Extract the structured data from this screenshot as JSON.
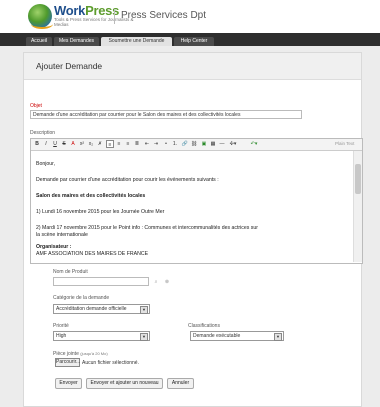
{
  "header": {
    "logo_word1": "Work",
    "logo_word2": "Press",
    "logo_tagline": "Tools & Press Services for Journalists & Medias",
    "title": "Press Services Dpt"
  },
  "tabs": [
    {
      "label": "Accueil",
      "active": false
    },
    {
      "label": "Mes Demandes",
      "active": false
    },
    {
      "label": "Soumettre une Demande",
      "active": true
    },
    {
      "label": "Help Center",
      "active": false
    }
  ],
  "panel": {
    "title": "Ajouter Demande"
  },
  "form": {
    "objet_label": "Objet",
    "objet_value": "Demande d'une accréditation par courrier pour le Salon des maires et des collectivités locales",
    "description_label": "Description",
    "editor_placeholder": "Plain Text",
    "editor_lines": [
      {
        "text": "Bonjour,",
        "bold": false
      },
      {
        "text": "Demande par courrier d'une accréditation pour courir les événements suivants :",
        "bold": false
      },
      {
        "text": "Salon des maires et des collectivités locales",
        "bold": true
      },
      {
        "text": "1) Lundi 16 novembre 2015 pour les Journée Outre Mer",
        "bold": false
      },
      {
        "text": "2) Mardi 17 novembre 2015 pour le Point info : Communes et intercommunalités des actrices sur",
        "bold": false
      },
      {
        "text": "la scène internationale",
        "bold": false
      },
      {
        "text": "Organisateur :",
        "bold": true
      },
      {
        "text": "AMF ASSOCIATION DES MAIRES DE FRANCE",
        "bold": false
      }
    ],
    "produit_label": "Nom de Produit",
    "produit_value": "",
    "categorie_label": "Catégorie de la demande",
    "categorie_value": "Accréditation demande officielle",
    "priorite_label": "Priorité",
    "priorite_value": "High",
    "classification_label": "Classifications",
    "classification_value": "Demande exécutable",
    "piece_label": "Pièce jointe",
    "piece_hint": "(jusqu'à 20 Mo)",
    "parcourir_label": "Parcourir...",
    "no_file_text": "Aucun fichier sélectionné."
  },
  "actions": {
    "envoyer": "Envoyer",
    "envoyer_nouveau": "Envoyer et ajouter un nouveau",
    "annuler": "Annuler"
  },
  "toolbar_icons": [
    "bold-icon",
    "italic-icon",
    "underline-icon",
    "strikethrough-icon",
    "font-color-icon",
    "superscript-icon",
    "subscript-icon",
    "clear-format-icon",
    "align-left-icon",
    "align-center-icon",
    "align-right-icon",
    "align-justify-icon",
    "outdent-icon",
    "indent-icon",
    "bullet-list-icon",
    "numbered-list-icon",
    "link-icon",
    "unlink-icon",
    "image-icon",
    "table-icon",
    "horizontal-rule-icon",
    "more-icon",
    "undo-icon"
  ]
}
